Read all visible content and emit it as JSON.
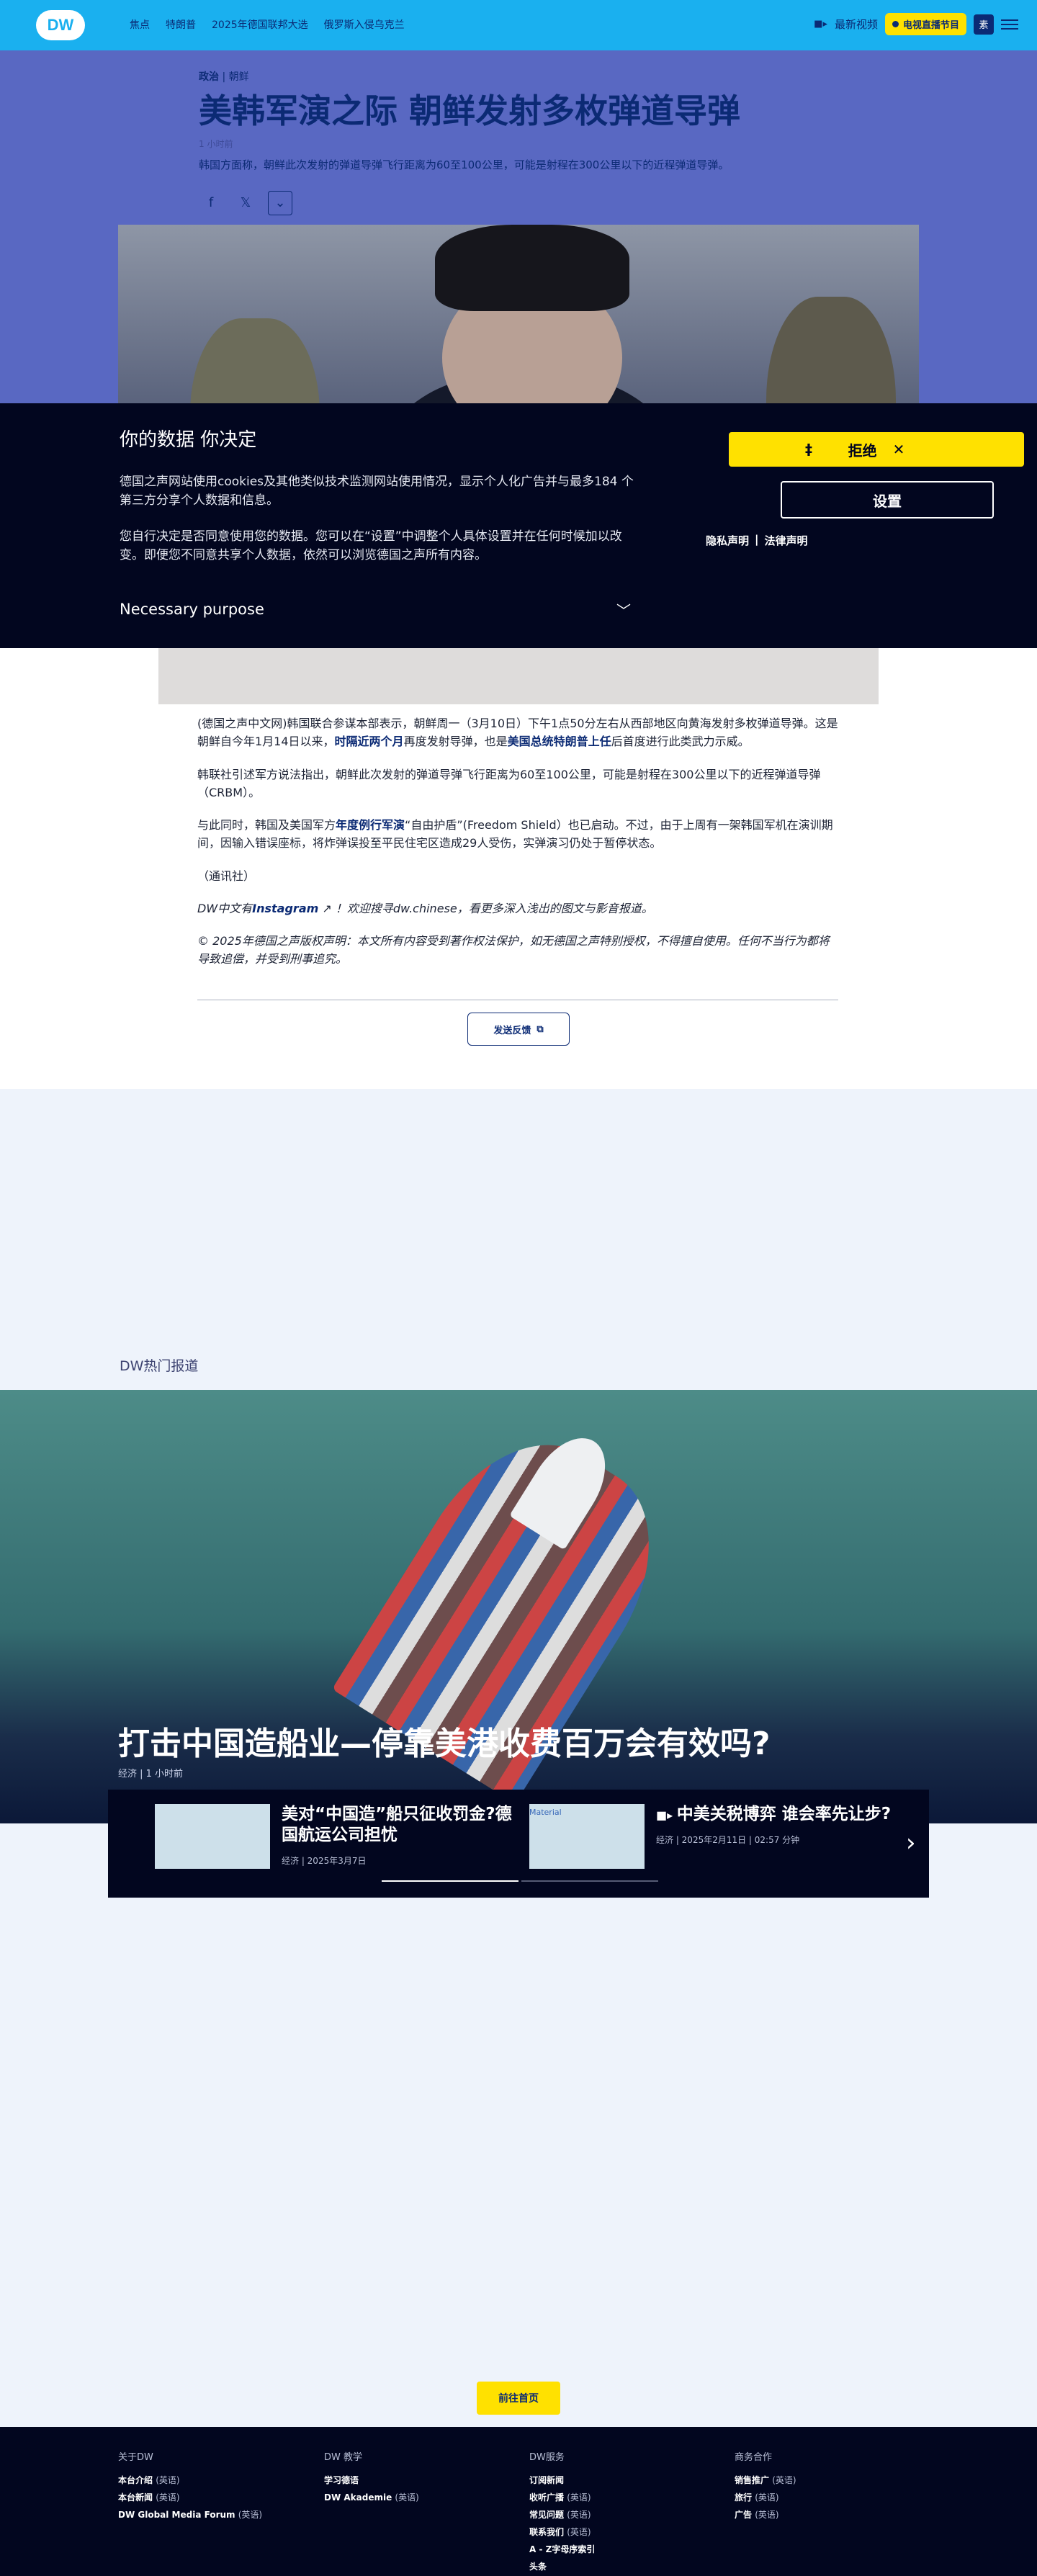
{
  "nav": {
    "logo": "DW",
    "links": [
      "焦点",
      "特朗普",
      "2025年德国联邦大选",
      "俄罗斯入侵乌克兰"
    ],
    "latest_video": "最新视频",
    "live_label": "电视直播节目",
    "search_label": "素"
  },
  "article": {
    "kicker_topic": "政治",
    "kicker_sep": "|",
    "kicker_region": "朝鲜",
    "title": "美韩军演之际 朝鲜发射多枚弹道导弹",
    "time": "1 小时前",
    "lead": "韩国方面称，朝鲜此次发射的弹道导弹飞行距离为60至100公里，可能是射程在300公里以下的近程弹道导弹。"
  },
  "consent": {
    "title": "你的数据 你决定",
    "p1": "德国之声网站使用cookies及其他类似技术监测网站使用情况，显示个人化广告并与最多184 个第三方分享个人数据和信息。",
    "p2": "您自行决定是否同意使用您的数据。您可以在“设置”中调整个人具体设置并在任何时候加以改变。即便您不同意共享个人数据，依然可以浏览德国之声所有内容。",
    "purpose": "Necessary purpose",
    "reject_lead": "‡",
    "reject": "拒绝",
    "settings": "设置",
    "privacy": "隐私声明",
    "legal": "法律声明"
  },
  "body": {
    "p1_a": "(德国之声中文网)韩国联合参谋本部表示，朝鲜周一（3月10日）下午1点50分左右从西部地区向黄海发射多枚弹道导弹。这是朝鲜自今年1月14日以来，",
    "p1_link1": "时隔近两个月",
    "p1_b": "再度发射导弹，也是",
    "p1_link2": "美国总统特朗普上任",
    "p1_c": "后首度进行此类武力示威。",
    "p2": "韩联社引述军方说法指出，朝鲜此次发射的弹道导弹飞行距离为60至100公里，可能是射程在300公里以下的近程弹道导弹（CRBM）。",
    "p3_a": "与此同时，韩国及美国军方",
    "p3_link": "年度例行军演",
    "p3_b": "“自由护盾”(Freedom Shield）也已启动。不过，由于上周有一架韩国军机在演训期间，因输入错误座标，将炸弹误投至平民住宅区造成29人受伤，实弹演习仍处于暂停状态。",
    "p4": "（通讯社）",
    "p5_a": "DW中文有",
    "p5_link": "Instagram",
    "p5_b": "！欢迎搜寻dw.chinese，看更多深入浅出的图文与影音报道。",
    "p6": "© 2025年德国之声版权声明：本文所有内容受到著作权法保护，如无德国之声特别授权，不得擅自使用。任何不当行为都将导致追偿，并受到刑事追究。",
    "feedback": "发送反馈"
  },
  "trending": {
    "label": "DW热门报道",
    "feature_title": "打击中国造船业—停靠美港收费百万会有效吗?",
    "feature_meta": "经济 | 1 小时前",
    "cards": [
      {
        "title": "美对“中国造”船只征收罚金?德国航运公司担忧",
        "meta": "经济 | 2025年3月7日"
      },
      {
        "title": "中美关税博弈 谁会率先让步?",
        "meta": "经济 | 2025年2月11日 | 02:57 分钟",
        "alt": "Material"
      }
    ],
    "goto_home": "前往首页"
  },
  "footer": {
    "cols": [
      {
        "heading": "关于DW",
        "items": [
          [
            "本台介绍",
            "(英语)"
          ],
          [
            "本台新闻",
            "(英语)"
          ],
          [
            "DW Global Media Forum",
            "(英语)"
          ]
        ]
      },
      {
        "heading": "DW 教学",
        "items": [
          [
            "学习德语",
            ""
          ],
          [
            "DW Akademie",
            "(英语)"
          ]
        ]
      },
      {
        "heading": "DW服务",
        "items": [
          [
            "订阅新闻",
            ""
          ],
          [
            "收听广播",
            "(英语)"
          ],
          [
            "常见问题",
            "(英语)"
          ],
          [
            "联系我们",
            "(英语)"
          ],
          [
            "A - Z字母序索引",
            ""
          ],
          [
            "头条",
            ""
          ]
        ]
      },
      {
        "heading": "商务合作",
        "items": [
          [
            "销售推广",
            "(英语)"
          ],
          [
            "旅行",
            "(英语)"
          ],
          [
            "广告",
            "(英语)"
          ]
        ]
      }
    ]
  },
  "colors": {
    "nav": "#1ab0ef",
    "brand_dark": "#0b2a74",
    "accent": "#ffe100",
    "consent_bg": "#02061f"
  }
}
